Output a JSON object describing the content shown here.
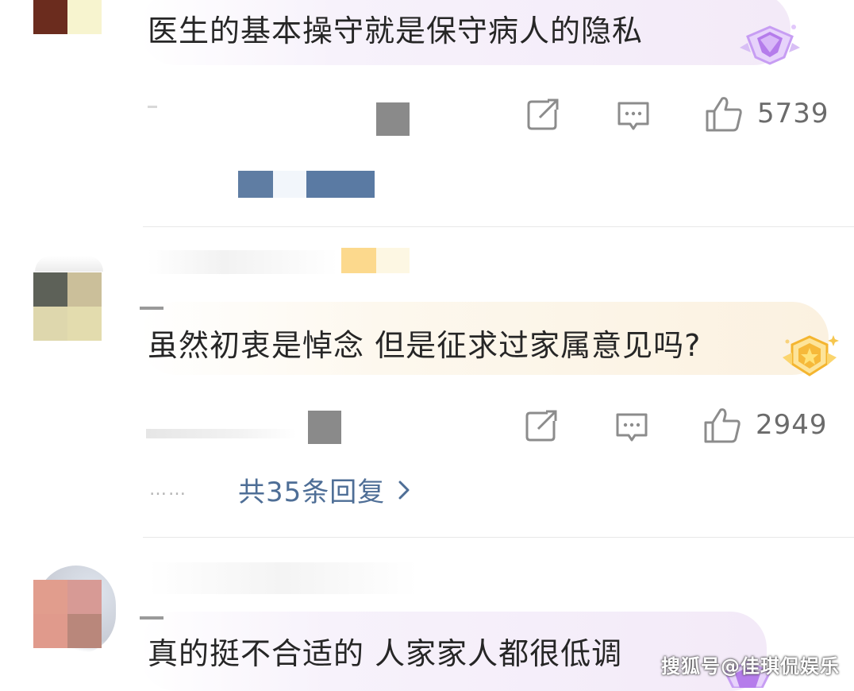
{
  "comments": [
    {
      "text": "医生的基本操守就是保守病人的隐私",
      "like_count": "5739",
      "badge": "purple-diamond-badge",
      "accent": "#a778e0"
    },
    {
      "text": "虽然初衷是悼念 但是征求过家属意见吗?",
      "like_count": "2949",
      "badge": "gold-star-badge",
      "accent": "#f3b62e",
      "replies_label": "共35条回复",
      "replies_dots": "……"
    },
    {
      "text": "真的挺不合适的 人家家人都很低调"
    }
  ],
  "watermark": "搜狐号@佳琪侃娱乐",
  "icons": {
    "share": "share-icon",
    "comment": "comment-icon",
    "like": "thumbs-up-icon",
    "chevron": "chevron-right-icon"
  }
}
